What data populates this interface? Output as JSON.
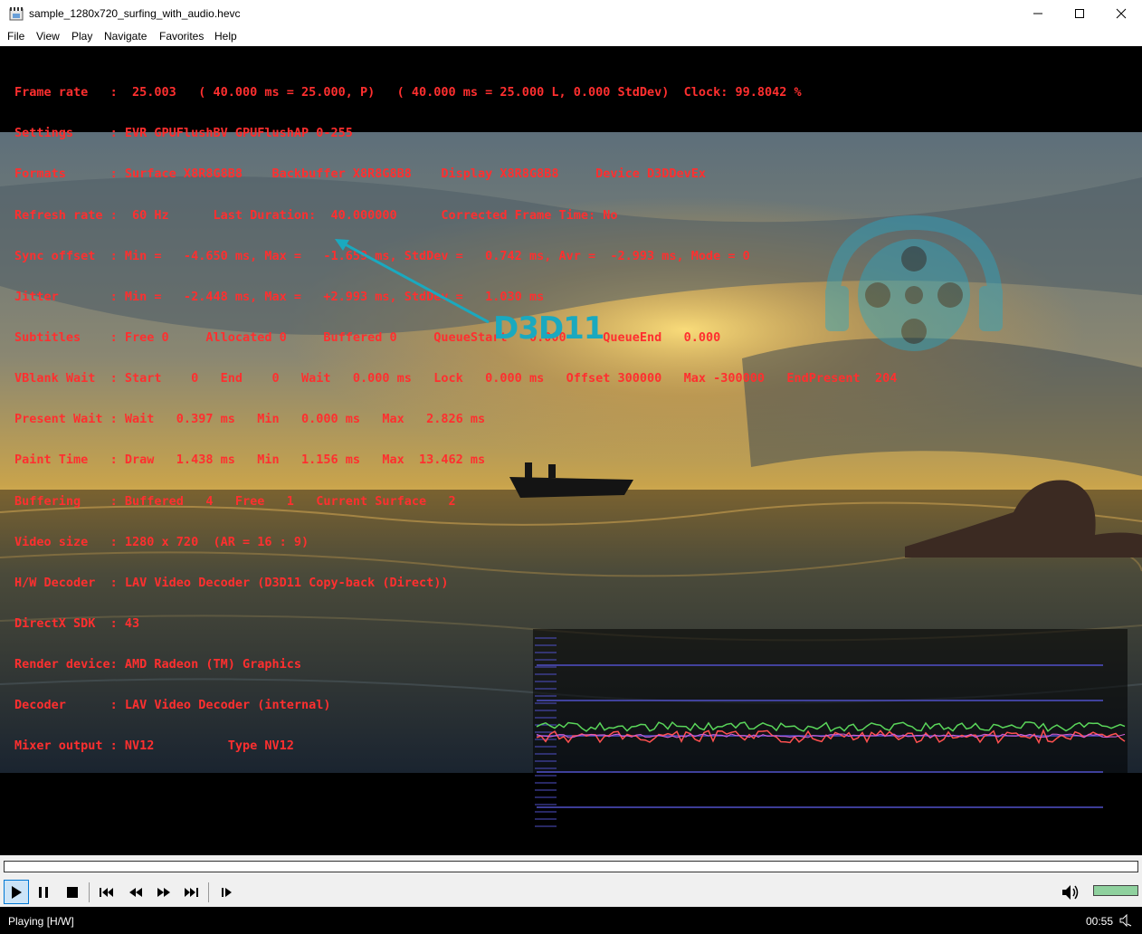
{
  "window": {
    "title": "sample_1280x720_surfing_with_audio.hevc",
    "minimize_icon": "minimize-icon",
    "maximize_icon": "maximize-icon",
    "close_icon": "close-icon"
  },
  "menu": [
    "File",
    "View",
    "Play",
    "Navigate",
    "Favorites",
    "Help"
  ],
  "stats": [
    "Frame rate   :  25.003   ( 40.000 ms = 25.000, P)   ( 40.000 ms = 25.000 L, 0.000 StdDev)  Clock: 99.8042 %",
    "Settings     : EVR GPUFlushBV GPUFlushAP 0-255",
    "Formats      : Surface X8R8G8B8    Backbuffer X8R8G8B8    Display X8R8G8B8     Device D3DDevEx",
    "Refresh rate :  60 Hz      Last Duration:  40.000000      Corrected Frame Time: No",
    "Sync offset  : Min =   -4.650 ms, Max =   -1.659 ms, StdDev =   0.742 ms, Avr =  -2.993 ms, Mode = 0",
    "Jitter       : Min =   -2.448 ms, Max =   +2.993 ms, StdDev =   1.030 ms",
    "Subtitles    : Free 0     Allocated 0     Buffered 0     QueueStart   0.000     QueueEnd   0.000",
    "VBlank Wait  : Start    0   End    0   Wait   0.000 ms   Lock   0.000 ms   Offset 300000   Max -300000   EndPresent  204",
    "Present Wait : Wait   0.397 ms   Min   0.000 ms   Max   2.826 ms",
    "Paint Time   : Draw   1.438 ms   Min   1.156 ms   Max  13.462 ms",
    "Buffering    : Buffered   4   Free   1   Current Surface   2",
    "Video size   : 1280 x 720  (AR = 16 : 9)",
    "H/W Decoder  : LAV Video Decoder (D3D11 Copy-back (Direct))",
    "DirectX SDK  : 43",
    "Render device: AMD Radeon (TM) Graphics",
    "Decoder      : LAV Video Decoder (internal)",
    "Mixer output : NV12          Type NV12"
  ],
  "annotation": {
    "label": "D3D11",
    "color": "#1aa9bf"
  },
  "watermark_icon": "film-reel-headphones-icon",
  "graph": {
    "series_colors": [
      "#5ad65a",
      "#ff5050",
      "#d860d8"
    ],
    "line_color": "#5050c8"
  },
  "controls": {
    "play_icon": "play-icon",
    "pause_icon": "pause-icon",
    "stop_icon": "stop-icon",
    "prev_icon": "skip-back-icon",
    "rewind_icon": "rewind-icon",
    "forward_icon": "fast-forward-icon",
    "next_icon": "skip-forward-icon",
    "frame_step_icon": "frame-step-icon",
    "volume_icon": "speaker-icon",
    "volume_level": 1.0
  },
  "status": {
    "text": "Playing [H/W]",
    "time": "00:55",
    "mute_icon": "mute-icon"
  }
}
